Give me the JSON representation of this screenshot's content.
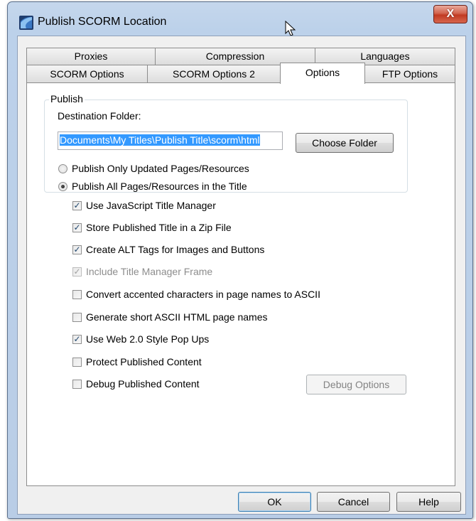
{
  "window": {
    "title": "Publish SCORM Location",
    "close_label": "X"
  },
  "tabs": {
    "row_back": [
      {
        "label": "Proxies"
      },
      {
        "label": "Compression"
      },
      {
        "label": "Languages"
      }
    ],
    "row_front": [
      {
        "label": "SCORM Options"
      },
      {
        "label": "SCORM Options 2"
      },
      {
        "label": "Options",
        "active": true
      },
      {
        "label": "FTP Options"
      }
    ]
  },
  "publish_group": {
    "legend": "Publish",
    "destination_label": "Destination Folder:",
    "destination_value": "Documents\\My Titles\\Publish Title\\scorm\\html",
    "choose_folder_label": "Choose Folder",
    "radios": [
      {
        "label": "Publish Only Updated Pages/Resources",
        "checked": false
      },
      {
        "label": "Publish All Pages/Resources in the Title",
        "checked": true
      }
    ]
  },
  "options": [
    {
      "label": "Use JavaScript Title Manager",
      "checked": true,
      "enabled": true
    },
    {
      "label": "Store Published Title in a Zip File",
      "checked": true,
      "enabled": true
    },
    {
      "label": "Create ALT Tags for Images and Buttons",
      "checked": true,
      "enabled": true
    },
    {
      "label": "Include Title Manager Frame",
      "checked": true,
      "enabled": false
    },
    {
      "label": "Convert accented characters in page names to ASCII",
      "checked": false,
      "enabled": true
    },
    {
      "label": "Generate short ASCII HTML page names",
      "checked": false,
      "enabled": true
    },
    {
      "label": "Use Web 2.0 Style Pop Ups",
      "checked": true,
      "enabled": true
    },
    {
      "label": "Protect Published Content",
      "checked": false,
      "enabled": true
    },
    {
      "label": "Debug Published Content",
      "checked": false,
      "enabled": true
    }
  ],
  "debug_options_label": "Debug Options",
  "footer": {
    "ok_label": "OK",
    "cancel_label": "Cancel",
    "help_label": "Help"
  }
}
